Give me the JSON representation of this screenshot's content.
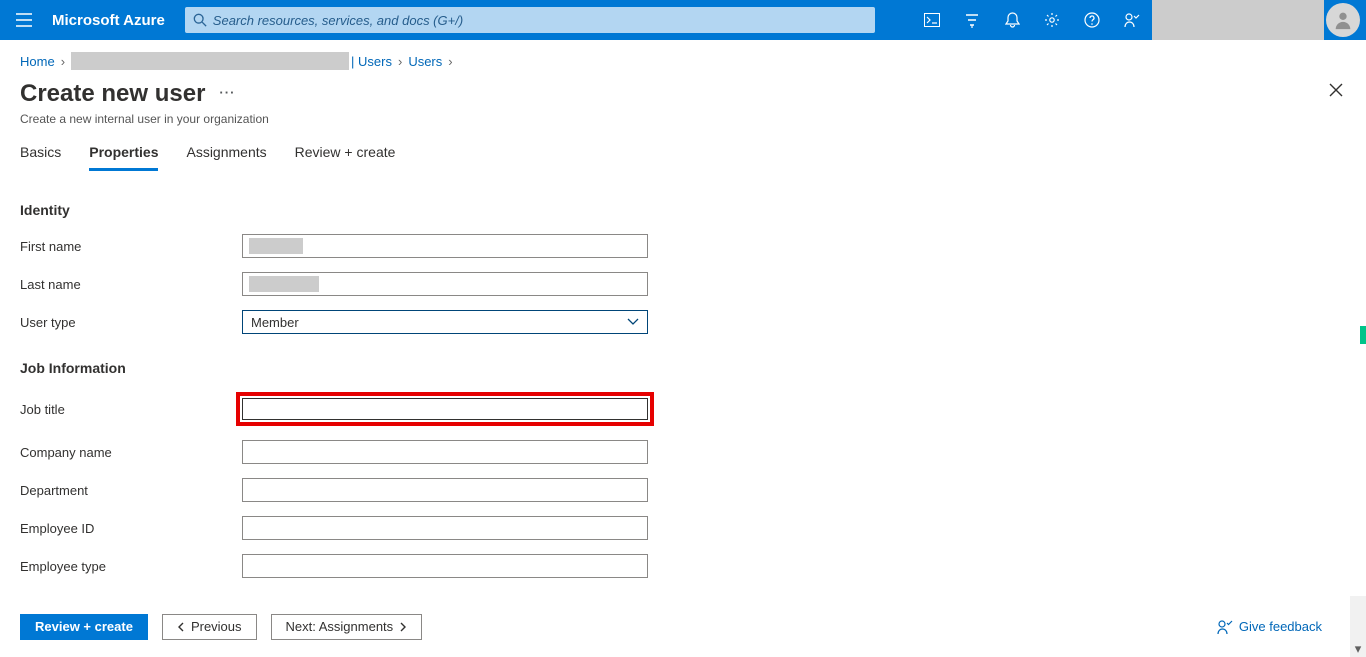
{
  "header": {
    "brand": "Microsoft Azure",
    "search_placeholder": "Search resources, services, and docs (G+/)"
  },
  "breadcrumb": {
    "home": "Home",
    "item1_suffix": "| Users",
    "item2": "Users"
  },
  "page": {
    "title": "Create new user",
    "subtitle": "Create a new internal user in your organization"
  },
  "tabs": {
    "basics": "Basics",
    "properties": "Properties",
    "assignments": "Assignments",
    "review": "Review + create"
  },
  "sections": {
    "identity": {
      "heading": "Identity",
      "fields": {
        "first_name": "First name",
        "last_name": "Last name",
        "user_type": "User type",
        "user_type_value": "Member"
      }
    },
    "job": {
      "heading": "Job Information",
      "fields": {
        "job_title": "Job title",
        "company_name": "Company name",
        "department": "Department",
        "employee_id": "Employee ID",
        "employee_type": "Employee type"
      }
    }
  },
  "footer": {
    "review_create": "Review + create",
    "previous": "Previous",
    "next": "Next: Assignments",
    "feedback": "Give feedback"
  }
}
